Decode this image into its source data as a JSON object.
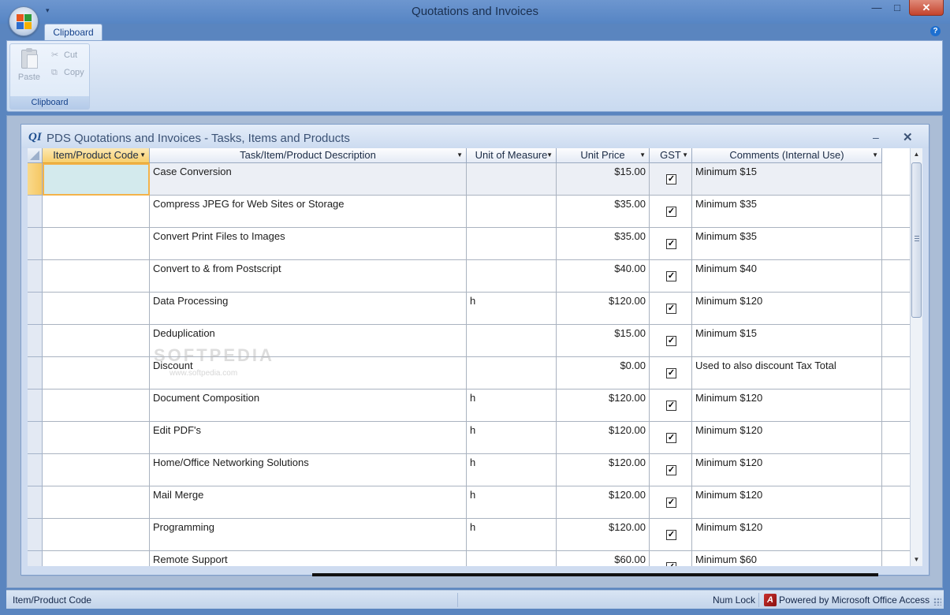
{
  "app": {
    "title": "Quotations and Invoices",
    "qat_arrow": "▾",
    "controls": {
      "minimize": "—",
      "maximize": "□",
      "close": "✕"
    }
  },
  "ribbon": {
    "tabs": [
      {
        "label": "Clipboard",
        "active": true
      }
    ],
    "help": "?",
    "group": {
      "label": "Clipboard",
      "paste_label": "Paste",
      "cut_label": "Cut",
      "copy_label": "Copy"
    }
  },
  "child_window": {
    "icon_text": "QI",
    "title": "PDS Quotations and Invoices - Tasks, Items and Products",
    "minimize": "–",
    "close": "✕"
  },
  "grid": {
    "columns": [
      {
        "key": "code",
        "label": "Item/Product Code"
      },
      {
        "key": "desc",
        "label": "Task/Item/Product Description"
      },
      {
        "key": "uom",
        "label": "Unit of Measure"
      },
      {
        "key": "price",
        "label": "Unit Price"
      },
      {
        "key": "gst",
        "label": "GST"
      },
      {
        "key": "comments",
        "label": "Comments (Internal Use)"
      }
    ],
    "rows": [
      {
        "code": "",
        "desc": "Case Conversion",
        "uom": "",
        "price": "$15.00",
        "gst": true,
        "comments": "Minimum $15"
      },
      {
        "code": "",
        "desc": "Compress JPEG for Web Sites or Storage",
        "uom": "",
        "price": "$35.00",
        "gst": true,
        "comments": "Minimum $35"
      },
      {
        "code": "",
        "desc": "Convert Print Files to Images",
        "uom": "",
        "price": "$35.00",
        "gst": true,
        "comments": "Minimum $35"
      },
      {
        "code": "",
        "desc": "Convert to & from Postscript",
        "uom": "",
        "price": "$40.00",
        "gst": true,
        "comments": "Minimum $40"
      },
      {
        "code": "",
        "desc": "Data Processing",
        "uom": "h",
        "price": "$120.00",
        "gst": true,
        "comments": "Minimum $120"
      },
      {
        "code": "",
        "desc": "Deduplication",
        "uom": "",
        "price": "$15.00",
        "gst": true,
        "comments": "Minimum $15"
      },
      {
        "code": "",
        "desc": "Discount",
        "uom": "",
        "price": "$0.00",
        "gst": true,
        "comments": "Used to also discount Tax Total"
      },
      {
        "code": "",
        "desc": "Document Composition",
        "uom": "h",
        "price": "$120.00",
        "gst": true,
        "comments": "Minimum $120"
      },
      {
        "code": "",
        "desc": "Edit PDF's",
        "uom": "h",
        "price": "$120.00",
        "gst": true,
        "comments": "Minimum $120"
      },
      {
        "code": "",
        "desc": "Home/Office Networking Solutions",
        "uom": "h",
        "price": "$120.00",
        "gst": true,
        "comments": "Minimum $120"
      },
      {
        "code": "",
        "desc": "Mail Merge",
        "uom": "h",
        "price": "$120.00",
        "gst": true,
        "comments": "Minimum $120"
      },
      {
        "code": "",
        "desc": "Programming",
        "uom": "h",
        "price": "$120.00",
        "gst": true,
        "comments": "Minimum $120"
      },
      {
        "code": "",
        "desc": "Remote Support",
        "uom": "",
        "price": "$60.00",
        "gst": true,
        "comments": "Minimum $60"
      }
    ],
    "selected_row": 0,
    "check_glyph": "✓",
    "dropdown_glyph": "▼"
  },
  "watermark": {
    "text": "SOFTPEDIA",
    "sub": "www.softpedia.com"
  },
  "statusbar": {
    "left": "Item/Product Code",
    "numlock": "Num Lock",
    "access_icon": "A",
    "powered": "Powered by Microsoft Office Access"
  },
  "scrollbar": {
    "up": "▲",
    "down": "▼",
    "position": 0.0
  },
  "colors": {
    "accent": "#5a85bf",
    "ribbon": "#d5e2f3",
    "selected_header": "#f8cf6c",
    "active_cell": "#d3eaed"
  }
}
